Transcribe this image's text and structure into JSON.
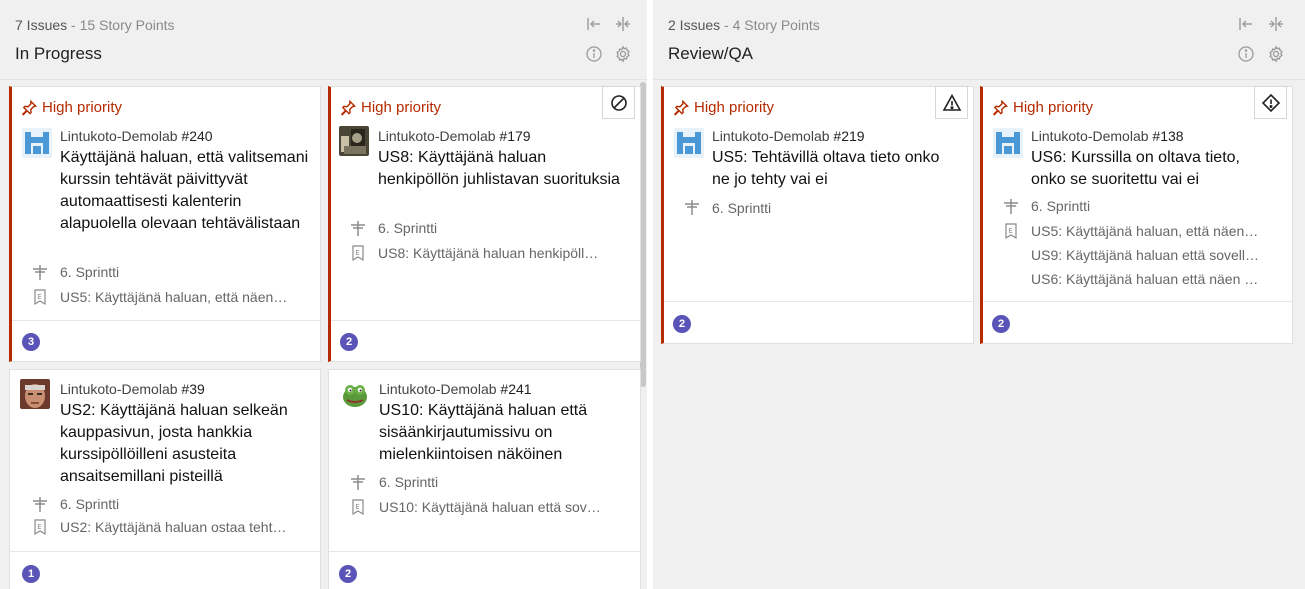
{
  "colors": {
    "priority": "#b52a00",
    "badge": "#5b54b8",
    "column_bg": "#f0f0f0"
  },
  "columns": [
    {
      "issues": "7 Issues",
      "separator": "-",
      "points": "15 Story Points",
      "title": "In Progress",
      "icons": [
        "collapse-left-icon",
        "collapse-icon",
        "info-icon",
        "settings-icon"
      ]
    },
    {
      "issues": "2 Issues",
      "separator": "-",
      "points": "4 Story Points",
      "title": "Review/QA",
      "icons": [
        "collapse-left-icon",
        "collapse-icon",
        "info-icon",
        "settings-icon"
      ]
    }
  ],
  "cards": [
    {
      "priority": "High priority",
      "project": "Lintukoto-Demolab",
      "number": "#240",
      "title": "Käyttäjänä haluan, että valitsemani kurssin tehtävät päivittyvät automaattisesti kalenterin alapuolella olevaan tehtävälistaan",
      "sprint": "6. Sprintti",
      "stories": [
        "US5: Käyttäjänä haluan, että näen…"
      ],
      "points": "3",
      "flag": "",
      "avatar": "castle-logo"
    },
    {
      "priority": "High priority",
      "project": "Lintukoto-Demolab",
      "number": "#179",
      "title": "US8: Käyttäjänä haluan henkipöllön juhlistavan suorituksia",
      "sprint": "6. Sprintti",
      "stories": [
        "US8: Käyttäjänä haluan henkipöll…"
      ],
      "points": "2",
      "flag": "blocked-icon",
      "avatar": "photo"
    },
    {
      "priority": "",
      "project": "Lintukoto-Demolab",
      "number": "#39",
      "title": "US2: Käyttäjänä haluan selkeän kauppasivun, josta hankkia kurssipöllöilleni asusteita ansaitsemillani pisteillä",
      "sprint": "6. Sprintti",
      "stories": [
        "US2: Käyttäjänä haluan ostaa teht…"
      ],
      "points": "1",
      "flag": "",
      "avatar": "face"
    },
    {
      "priority": "",
      "project": "Lintukoto-Demolab",
      "number": "#241",
      "title": "US10: Käyttäjänä haluan että sisäänkirjautumissivu on mielenkiintoisen näköinen",
      "sprint": "6. Sprintti",
      "stories": [
        "US10: Käyttäjänä haluan että sov…"
      ],
      "points": "2",
      "flag": "",
      "avatar": "frog"
    },
    {
      "priority": "High priority",
      "project": "Lintukoto-Demolab",
      "number": "#219",
      "title": "US5: Tehtävillä oltava tieto onko ne jo tehty vai ei",
      "sprint": "6. Sprintti",
      "stories": [],
      "points": "2",
      "flag": "warning-icon",
      "avatar": "castle-logo"
    },
    {
      "priority": "High priority",
      "project": "Lintukoto-Demolab",
      "number": "#138",
      "title": "US6: Kurssilla on oltava tieto, onko se suoritettu vai ei",
      "sprint": "6. Sprintti",
      "stories": [
        "US5: Käyttäjänä haluan, että näen…",
        "US9: Käyttäjänä haluan että sovell…",
        "US6: Käyttäjänä haluan että näen …"
      ],
      "points": "2",
      "flag": "alert-diamond-icon",
      "avatar": "castle-logo"
    }
  ]
}
